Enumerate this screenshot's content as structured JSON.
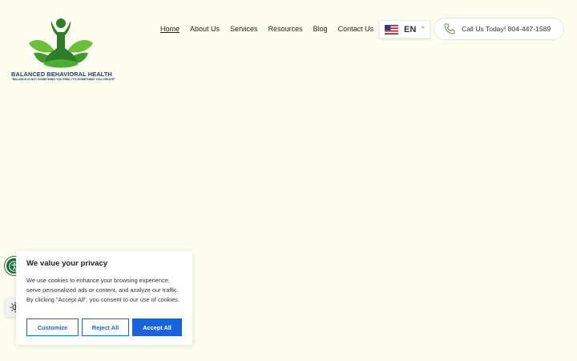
{
  "logo": {
    "title": "BALANCED BEHAVIORAL HEALTH",
    "tagline": "\"BALANCE IS NOT SOMETHING YOU FIND, IT'S SOMETHING YOU CREATE\""
  },
  "nav": {
    "items": [
      {
        "label": "Home",
        "active": true
      },
      {
        "label": "About Us"
      },
      {
        "label": "Services"
      },
      {
        "label": "Resources"
      },
      {
        "label": "Blog"
      },
      {
        "label": "Contact Us"
      }
    ]
  },
  "language": {
    "code": "EN",
    "flag": "us-flag-icon"
  },
  "call": {
    "label": "Call Us Today! 804-447-1589",
    "icon": "phone-icon"
  },
  "cookie_banner": {
    "title": "We value your privacy",
    "text": "We use cookies to enhance your browsing experience, serve personalized ads or content, and analyze our traffic. By clicking \"Accept All\", you consent to our use of cookies.",
    "customize_label": "Customize",
    "reject_label": "Reject All",
    "accept_label": "Accept All"
  },
  "colors": {
    "background": "#fcfdef",
    "accent_blue": "#1863dc",
    "logo_green": "#4caf32",
    "logo_navy": "#1c3d6e",
    "a11y_green": "#1a6b33"
  }
}
